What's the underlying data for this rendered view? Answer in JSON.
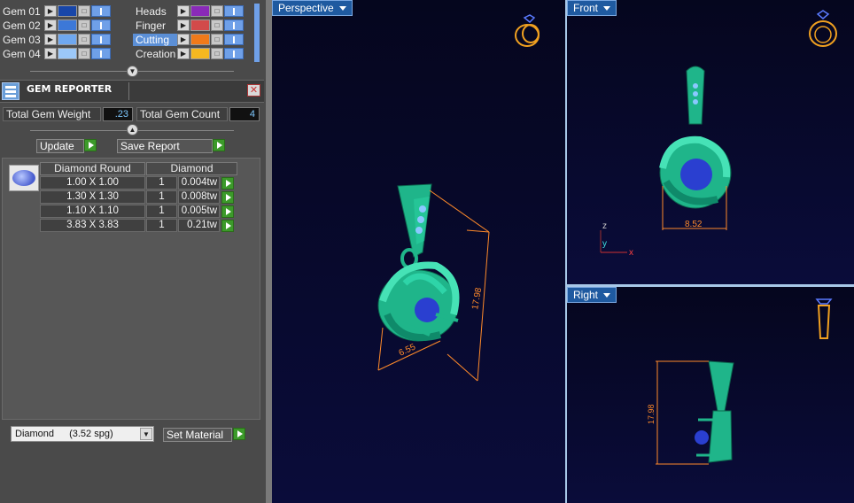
{
  "layers_left": [
    {
      "label": "Gem 01",
      "color": "#1846a8"
    },
    {
      "label": "Gem 02",
      "color": "#3c78d8"
    },
    {
      "label": "Gem 03",
      "color": "#6fa8f0"
    },
    {
      "label": "Gem 04",
      "color": "#9cc8f8"
    }
  ],
  "layers_right": [
    {
      "label": "Heads",
      "color": "#8a2ab8",
      "selected": false
    },
    {
      "label": "Finger",
      "color": "#d24a4a",
      "selected": false
    },
    {
      "label": "Cutting",
      "color": "#f07a1a",
      "selected": true
    },
    {
      "label": "Creation",
      "color": "#f5b820",
      "selected": false
    }
  ],
  "reporter": {
    "title": "GEM REPORTER",
    "total_weight_label": "Total Gem Weight",
    "total_weight_value": ".23",
    "total_count_label": "Total Gem Count",
    "total_count_value": "4",
    "update_label": "Update",
    "save_label": "Save Report",
    "col_shape": "Diamond Round",
    "col_material": "Diamond",
    "rows": [
      {
        "size": "1.00 X 1.00",
        "qty": "1",
        "weight": "0.004tw"
      },
      {
        "size": "1.30 X 1.30",
        "qty": "1",
        "weight": "0.008tw"
      },
      {
        "size": "1.10 X 1.10",
        "qty": "1",
        "weight": "0.005tw"
      },
      {
        "size": "3.83 X 3.83",
        "qty": "1",
        "weight": "0.21tw"
      }
    ]
  },
  "material": {
    "select_name": "Diamond",
    "select_spg": "(3.52 spg)",
    "set_label": "Set Material"
  },
  "viewports": {
    "perspective": {
      "label": "Perspective",
      "dim_a": "6.55",
      "dim_b": "17.98"
    },
    "front": {
      "label": "Front",
      "dim": "8.52",
      "axis_z": "z",
      "axis_y": "y",
      "axis_x": "x"
    },
    "right": {
      "label": "Right",
      "dim": "17.98"
    }
  },
  "colors": {
    "gem": "#2a3fd0",
    "metal": "#1fb58a",
    "dimension": "#ff8a2a"
  }
}
